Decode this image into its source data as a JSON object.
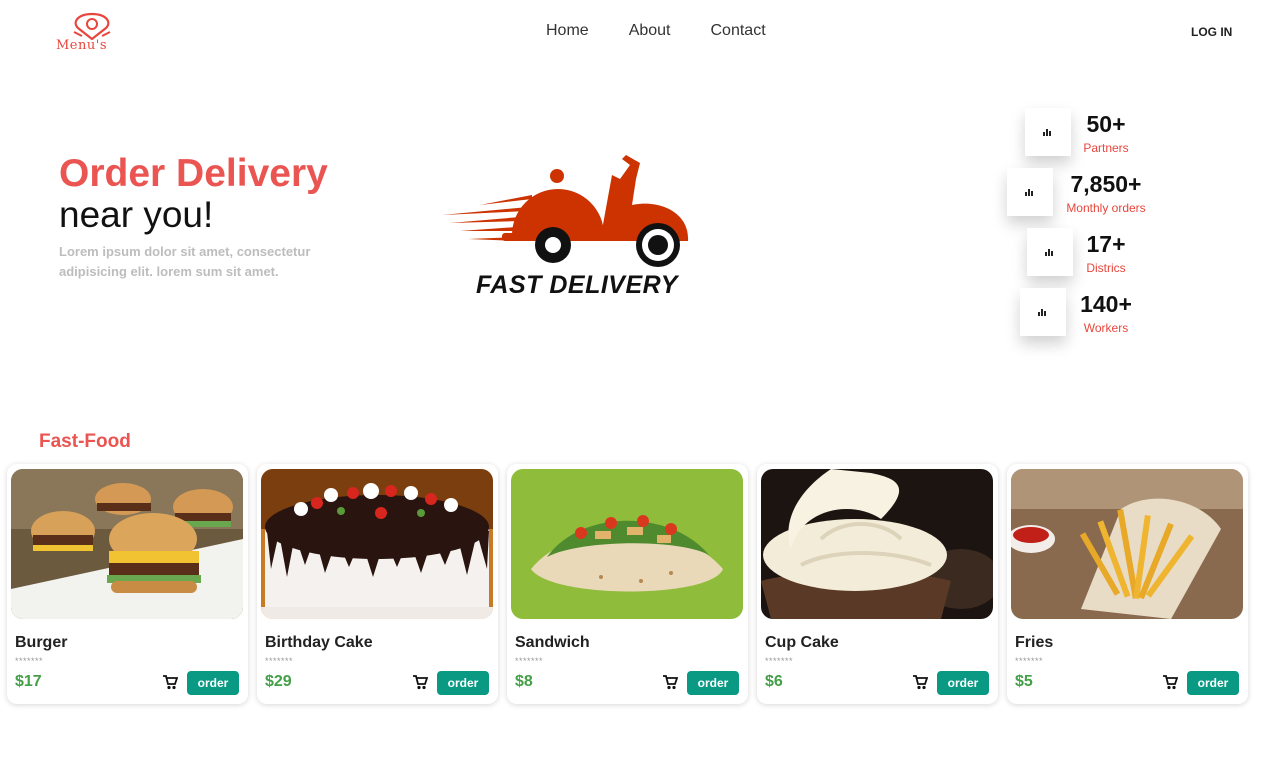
{
  "header": {
    "logo_text": "Menu's",
    "nav": [
      "Home",
      "About",
      "Contact"
    ],
    "login": "LOG IN"
  },
  "hero": {
    "title": "Order Delivery",
    "subtitle": "near you!",
    "description": "Lorem ipsum dolor sit amet, consectetur adipisicing elit. lorem sum sit amet.",
    "image_label": "FAST DELIVERY"
  },
  "stats": [
    {
      "value": "50+",
      "label": "Partners",
      "icon": "bar-chart-icon"
    },
    {
      "value": "7,850+",
      "label": "Monthly orders",
      "icon": "bar-chart-icon"
    },
    {
      "value": "17+",
      "label": "Districs",
      "icon": "bar-chart-icon"
    },
    {
      "value": "140+",
      "label": "Workers",
      "icon": "bar-chart-icon"
    }
  ],
  "food": {
    "title": "Fast-Food",
    "items": [
      {
        "name": "Burger",
        "rating": "*******",
        "price": "$17",
        "order": "order"
      },
      {
        "name": "Birthday Cake",
        "rating": "*******",
        "price": "$29",
        "order": "order"
      },
      {
        "name": "Sandwich",
        "rating": "*******",
        "price": "$8",
        "order": "order"
      },
      {
        "name": "Cup Cake",
        "rating": "*******",
        "price": "$6",
        "order": "order"
      },
      {
        "name": "Fries",
        "rating": "*******",
        "price": "$5",
        "order": "order"
      }
    ]
  },
  "colors": {
    "accent": "#ea5451",
    "price": "#43a047",
    "button": "#0a9a84",
    "scooter": "#cc3300"
  }
}
